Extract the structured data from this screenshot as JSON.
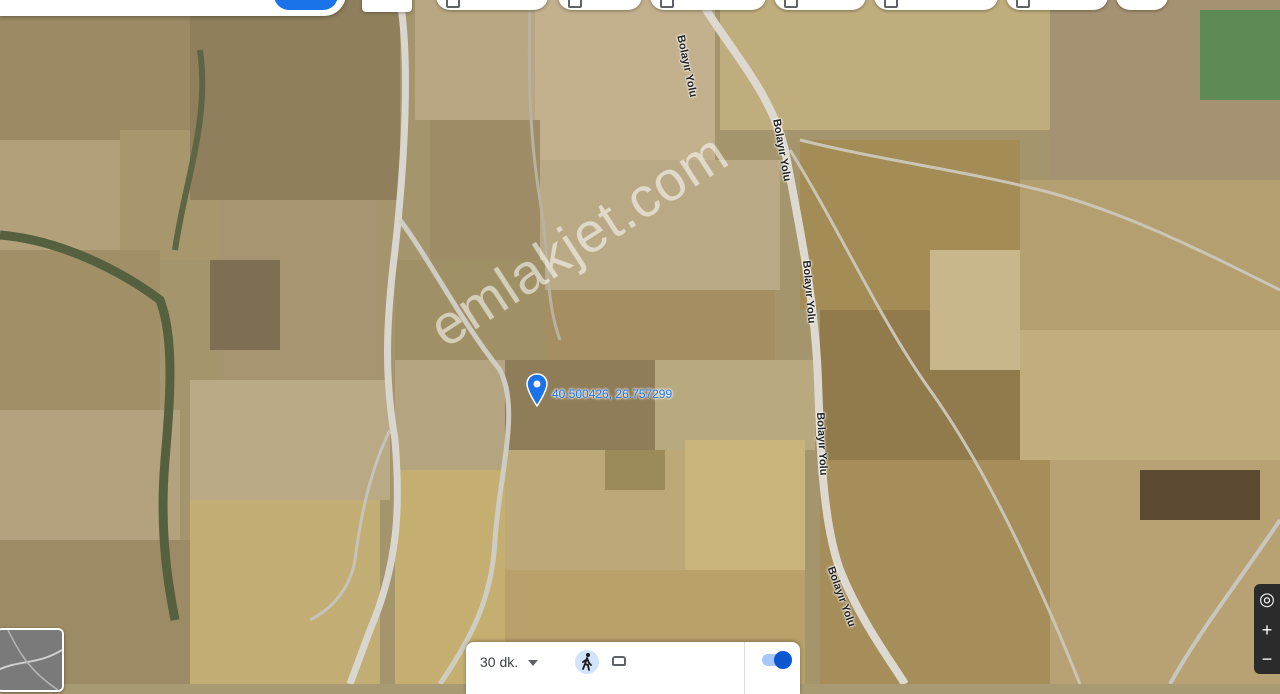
{
  "map": {
    "type": "satellite",
    "pin_coordinates": "40.500426, 26.757299",
    "watermark": "emlakjet.com",
    "road_labels": [
      "Bolayır Yolu",
      "Bolayır Yolu",
      "Bolayır Yolu",
      "Bolayır Yolu"
    ],
    "pin_color": "#1a73e8"
  },
  "bottom_panel": {
    "time": "30 dk.",
    "modes": [
      "walk-icon",
      "car-icon"
    ]
  },
  "controls": [
    "locate-icon",
    "zoom-in-icon",
    "zoom-out-icon"
  ]
}
